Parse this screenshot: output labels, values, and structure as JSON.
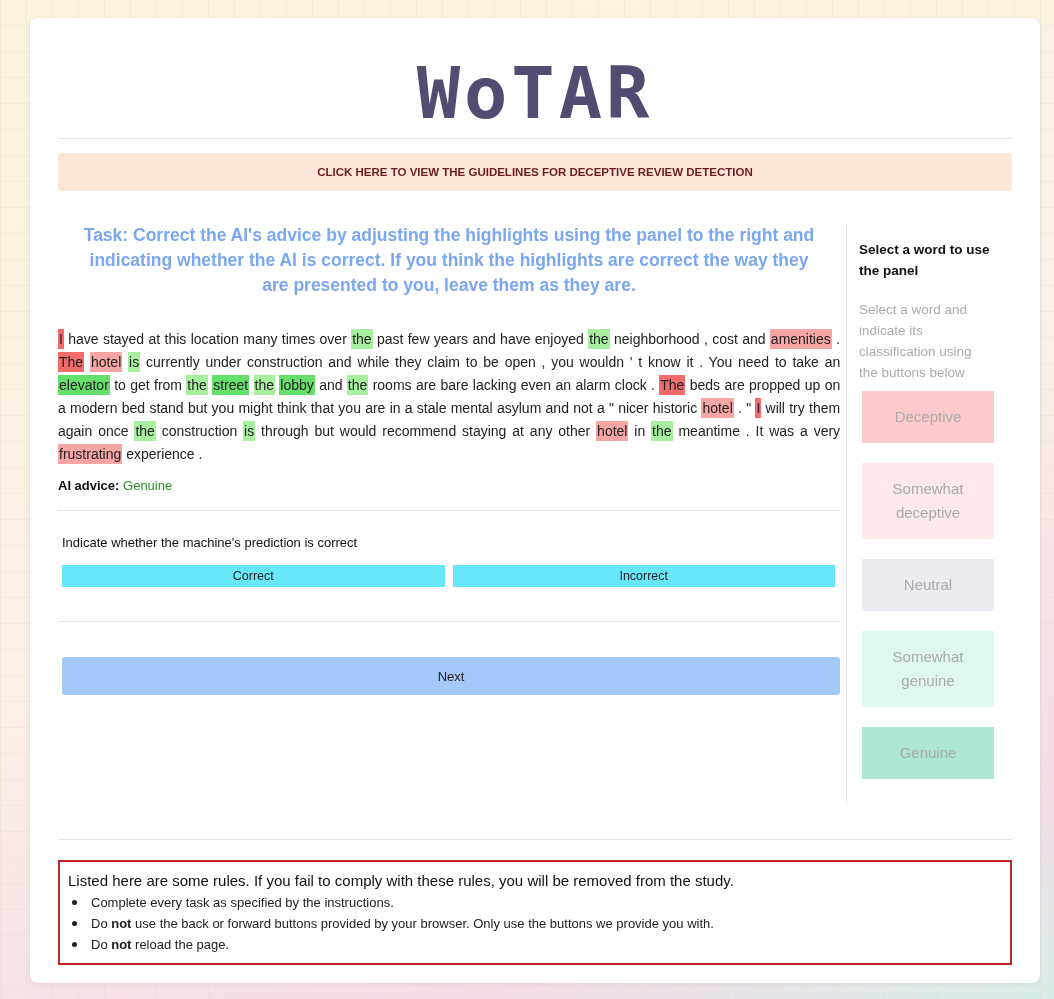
{
  "title": "WoTAR",
  "guidelines_link": "CLICK HERE TO VIEW THE GUIDELINES FOR DECEPTIVE REVIEW DETECTION",
  "task": {
    "instruction": "Task: Correct the AI's advice by adjusting the highlights using the panel to the right and indicating whether the AI is correct. If you think the highlights are correct the way they are presented to you, leave them as they are."
  },
  "review": {
    "segments": [
      {
        "text": "I",
        "color": "#f36b6b"
      },
      {
        "text": "have stayed at this location many times over"
      },
      {
        "text": "the",
        "color": "#a8f0a0"
      },
      {
        "text": "past few years and have enjoyed"
      },
      {
        "text": "the",
        "color": "#a8f0a0"
      },
      {
        "text": "neighborhood , cost and"
      },
      {
        "text": "amenities",
        "color": "#f8a5a5"
      },
      {
        "text": "."
      },
      {
        "text": "The",
        "color": "#f36b6b"
      },
      {
        "text": "hotel",
        "color": "#f8a5a5"
      },
      {
        "text": "is",
        "color": "#a8f0a0"
      },
      {
        "text": "currently under construction and while they claim to be open , you wouldn ' t know it . You need to take an"
      },
      {
        "text": "elevator",
        "color": "#66e06b"
      },
      {
        "text": "to get from"
      },
      {
        "text": "the",
        "color": "#a8f0a0"
      },
      {
        "text": "street",
        "color": "#66e06b"
      },
      {
        "text": "the",
        "color": "#a8f0a0"
      },
      {
        "text": "lobby",
        "color": "#66e06b"
      },
      {
        "text": "and"
      },
      {
        "text": "the",
        "color": "#a8f0a0"
      },
      {
        "text": "rooms are bare lacking even an alarm clock ."
      },
      {
        "text": "The",
        "color": "#f36b6b"
      },
      {
        "text": "beds are propped up on a modern bed stand but you might think that you are in a stale mental asylum and not a \" nicer historic"
      },
      {
        "text": "hotel",
        "color": "#f8a5a5"
      },
      {
        "text": ". \""
      },
      {
        "text": "I",
        "color": "#f36b6b"
      },
      {
        "text": "will try them again once"
      },
      {
        "text": "the",
        "color": "#a8f0a0"
      },
      {
        "text": "construction"
      },
      {
        "text": "is",
        "color": "#a8f0a0"
      },
      {
        "text": "through but would recommend staying at any other"
      },
      {
        "text": "hotel",
        "color": "#f8a5a5"
      },
      {
        "text": "in"
      },
      {
        "text": "the",
        "color": "#a8f0a0"
      },
      {
        "text": "meantime . It was a very"
      },
      {
        "text": "frustrating",
        "color": "#f8a5a5"
      },
      {
        "text": "experience ."
      }
    ]
  },
  "ai_advice": {
    "label": "AI advice:",
    "value": "Genuine"
  },
  "prediction": {
    "question": "Indicate whether the machine's prediction is correct",
    "buttons": [
      "Correct",
      "Incorrect"
    ]
  },
  "next_button": "Next",
  "panel": {
    "heading": "Select a word to use the panel",
    "hint": "Select a word and indicate its classification using the buttons below",
    "buttons": [
      {
        "label": "Deceptive",
        "color": "#fdcbcb"
      },
      {
        "label": "Somewhat deceptive",
        "color": "#fde9e9"
      },
      {
        "label": "Neutral",
        "color": "#ebecf1"
      },
      {
        "label": "Somewhat genuine",
        "color": "#e0f7ef"
      },
      {
        "label": "Genuine",
        "color": "#ade6d3"
      }
    ]
  },
  "rules": {
    "heading": "Listed here are some rules. If you fail to comply with these rules, you will be removed from the study.",
    "items": [
      "Complete every task as specified by the instructions.",
      "Do **not** use the back or forward buttons provided by your browser. Only use the buttons we provide you with.",
      "Do **not** reload the page."
    ]
  }
}
